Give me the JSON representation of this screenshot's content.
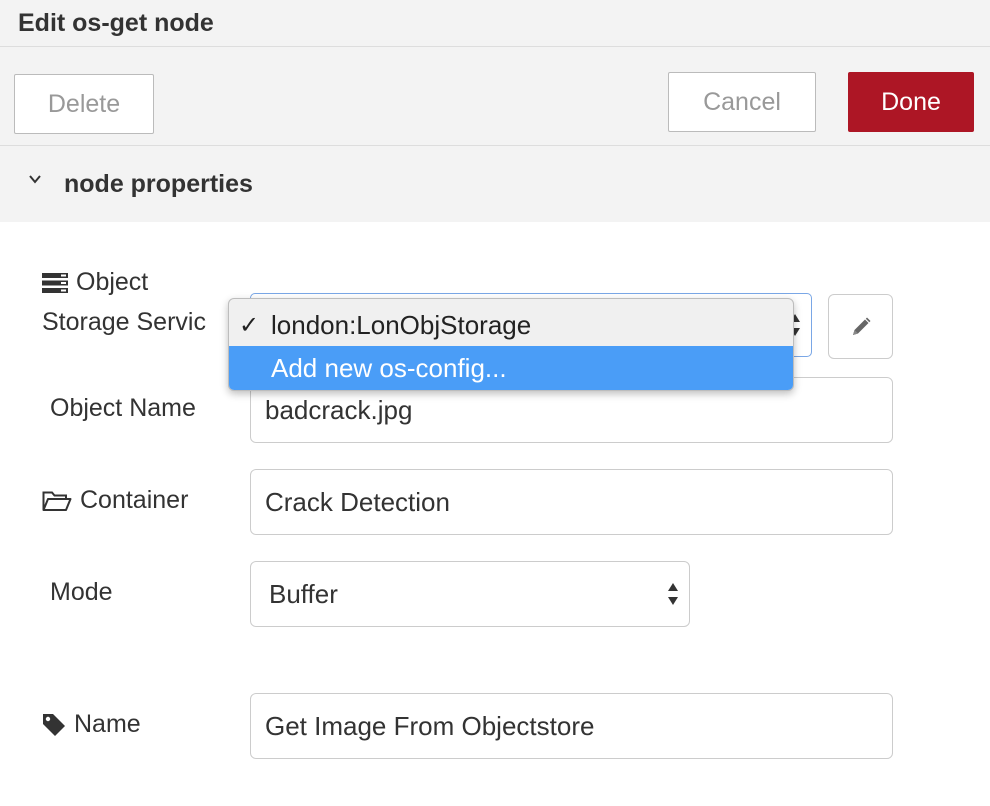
{
  "dialog": {
    "title": "Edit os-get node",
    "delete_label": "Delete",
    "cancel_label": "Cancel",
    "done_label": "Done",
    "done_color": "#ad1625"
  },
  "section": {
    "title": "node properties",
    "chevron_icon": "chevron-down-icon"
  },
  "fields": {
    "object_storage": {
      "label_line1": "Object",
      "label_line2": "Storage Servic",
      "icon": "server-icon",
      "options": [
        "london:LonObjStorage",
        "Add new os-config..."
      ],
      "selected": "london:LonObjStorage",
      "highlighted": "Add new os-config...",
      "edit_icon": "pencil-icon"
    },
    "object_name": {
      "label": "Object Name",
      "value": "badcrack.jpg"
    },
    "container": {
      "label": "Container",
      "icon": "folder-open-icon",
      "value": "Crack Detection"
    },
    "mode": {
      "label": "Mode",
      "value": "Buffer"
    },
    "name": {
      "label": "Name",
      "icon": "tag-icon",
      "value": "Get Image From Objectstore"
    }
  },
  "colors": {
    "highlight": "#4a9df7",
    "focus_border": "#7aa7e6"
  }
}
